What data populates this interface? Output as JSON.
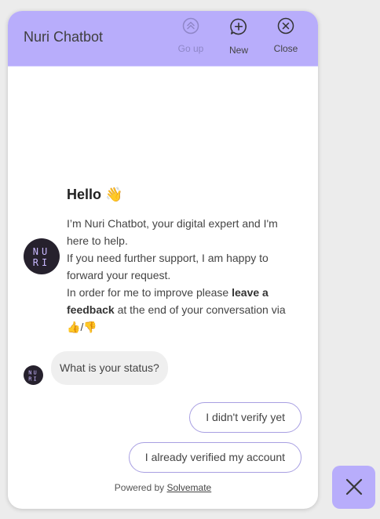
{
  "header": {
    "title": "Nuri Chatbot",
    "buttons": {
      "go_up": "Go up",
      "new": "New",
      "close": "Close"
    }
  },
  "chat": {
    "greeting": "Hello",
    "greeting_emoji": "👋",
    "intro_lines": {
      "line1": "I’m Nuri Chatbot, your digital expert and I'm here to help.",
      "line2": "If you need further support, I am happy to forward your request.",
      "line3_prefix": "In order for me to improve please ",
      "line3_bold": "leave a feedback",
      "line3_suffix": " at the end of your conversation via ",
      "thumbs_up": "👍",
      "slash": "/",
      "thumbs_down": "👎"
    },
    "question": "What is your status?"
  },
  "quick_replies": {
    "reply1": "I didn't verify yet",
    "reply2": "I already verified my account"
  },
  "footer": {
    "powered_by": "Powered by ",
    "brand_link": "Solvemate"
  },
  "avatar": {
    "text_top": "NU",
    "text_bottom": "RI"
  },
  "colors": {
    "accent": "#b8adfb",
    "reply_border": "#a89fe2",
    "avatar_bg": "#26212d",
    "avatar_text": "#c9b8ff"
  },
  "icons": {
    "go_up": "double-chevron-up-circle-icon",
    "new": "chat-plus-icon",
    "close": "x-circle-icon",
    "fab": "close-x-icon"
  }
}
